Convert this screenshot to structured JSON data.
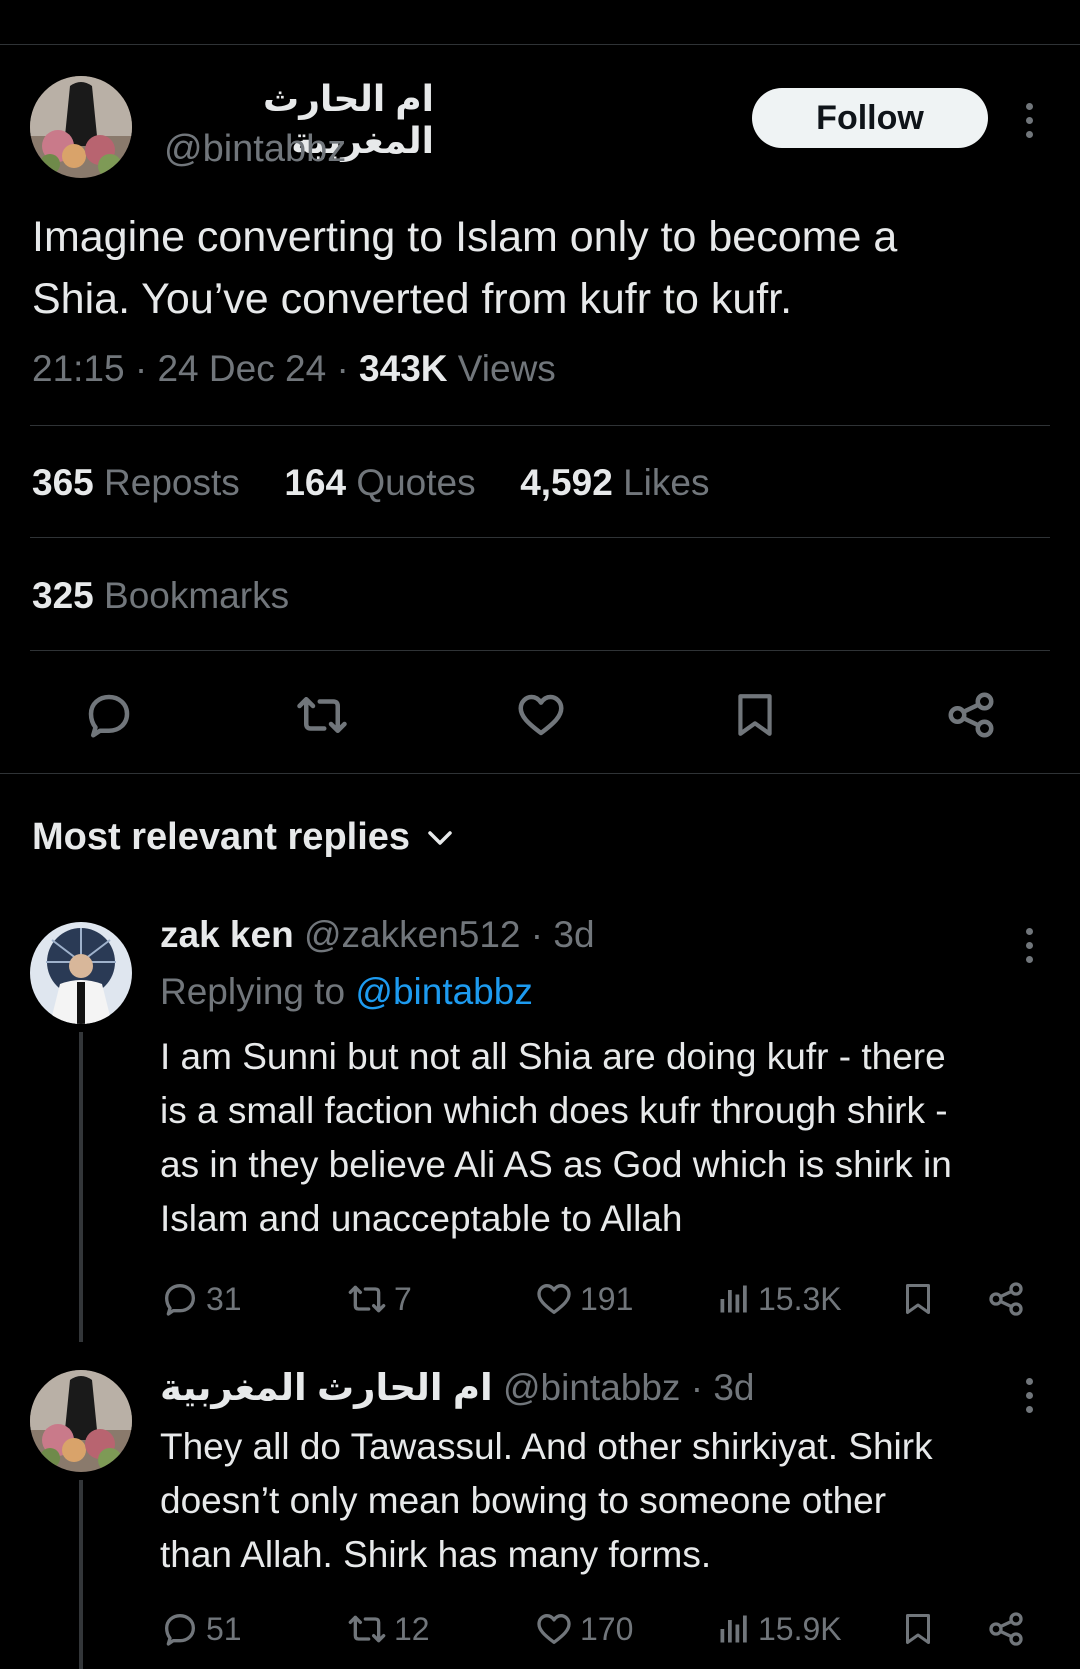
{
  "tweet": {
    "display_name": "ام الحارث المغربية",
    "handle": "@bintabbz",
    "follow_label": "Follow",
    "text_line1": "Imagine converting to Islam only to become a",
    "text_line2": "Shia. You’ve converted from kufr to kufr.",
    "time": "21:15",
    "date": "24 Dec 24",
    "sep": "·",
    "views_count": "343K",
    "views_label": "Views",
    "stats": {
      "reposts_count": "365",
      "reposts_label": "Reposts",
      "quotes_count": "164",
      "quotes_label": "Quotes",
      "likes_count": "4,592",
      "likes_label": "Likes",
      "bookmarks_count": "325",
      "bookmarks_label": "Bookmarks"
    },
    "actions": [
      "reply-icon",
      "retweet-icon",
      "heart-icon",
      "bookmark-icon",
      "share-icon"
    ]
  },
  "replies_header": {
    "label": "Most relevant replies"
  },
  "replies": [
    {
      "display_name": "zak ken",
      "handle": "@zakken512",
      "time_ago": "· 3d",
      "replying_prefix": "Replying to",
      "replying_handle": "@bintabbz",
      "lines": [
        "I am Sunni but not all Shia are doing kufr - there",
        "is a small faction which does kufr through shirk -",
        "as in they believe Ali AS as God which is shirk in",
        "Islam and unacceptable to Allah"
      ],
      "reply_count": "31",
      "repost_count": "7",
      "like_count": "191",
      "view_count": "15.3K"
    },
    {
      "display_name": "ام الحارث المغربية",
      "handle": "@bintabbz",
      "time_ago": "· 3d",
      "lines": [
        "They all do Tawassul. And other shirkiyat. Shirk",
        "doesn’t only mean bowing to someone other",
        "than Allah. Shirk has many forms."
      ],
      "reply_count": "51",
      "repost_count": "12",
      "like_count": "170",
      "view_count": "15.9K"
    }
  ],
  "colors": {
    "background": "#000000",
    "text": "#e7e9ea",
    "muted": "#71767b",
    "link": "#1d9bf0",
    "divider": "#2f3336"
  }
}
